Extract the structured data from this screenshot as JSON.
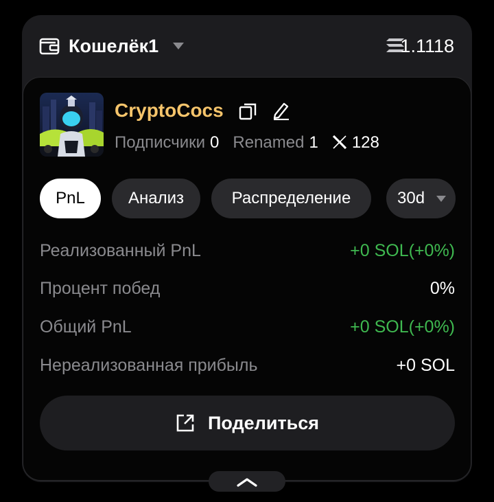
{
  "header": {
    "wallet_name": "Кошелёк1",
    "balance": "1.1118"
  },
  "profile": {
    "username": "CryptoCocs",
    "followers_label": "Подписчики",
    "followers_value": "0",
    "renamed_label": "Renamed",
    "renamed_value": "1",
    "x_followers_value": "128"
  },
  "tabs": [
    {
      "label": "PnL",
      "active": true
    },
    {
      "label": "Анализ",
      "active": false
    },
    {
      "label": "Распределение",
      "active": false
    }
  ],
  "period": {
    "selected": "30d"
  },
  "metrics": [
    {
      "label": "Реализованный PnL",
      "value": "+0 SOL(+0%)",
      "positive": true
    },
    {
      "label": "Процент побед",
      "value": "0%",
      "positive": false
    },
    {
      "label": "Общий PnL",
      "value": "+0 SOL(+0%)",
      "positive": true
    },
    {
      "label": "Нереализованная прибыль",
      "value": "+0 SOL",
      "positive": false
    }
  ],
  "share": {
    "label": "Поделиться"
  },
  "colors": {
    "accent_username": "#f5c46b",
    "positive": "#3fb950",
    "muted": "#8a8a8e",
    "card_bg": "#1c1c1f"
  },
  "icons": {
    "wallet": "wallet-icon",
    "caret": "chevron-down-icon",
    "balance": "solana-icon",
    "copy": "copy-icon",
    "edit": "pencil-icon",
    "x": "x-logo-icon",
    "share": "external-link-icon",
    "collapse": "chevron-up-icon"
  }
}
